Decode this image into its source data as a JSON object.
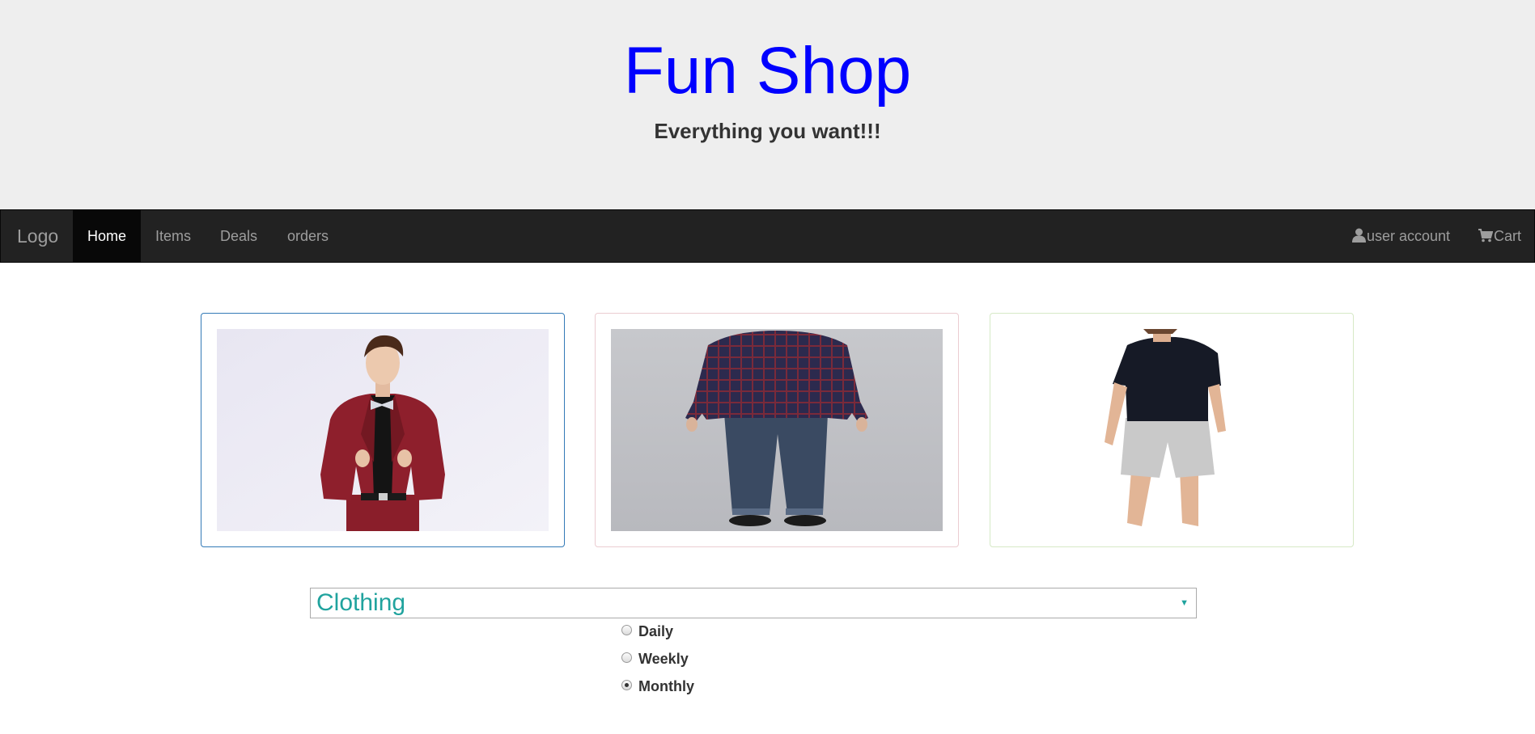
{
  "header": {
    "title": "Fun Shop",
    "tagline": "Everything you want!!!"
  },
  "navbar": {
    "brand": "Logo",
    "items": [
      {
        "label": "Home",
        "active": true
      },
      {
        "label": "Items",
        "active": false
      },
      {
        "label": "Deals",
        "active": false
      },
      {
        "label": "orders",
        "active": false
      }
    ],
    "right": [
      {
        "label": "user account",
        "icon": "user-icon"
      },
      {
        "label": "Cart",
        "icon": "cart-icon"
      }
    ]
  },
  "products": [
    {
      "image": "man in burgundy suit with bow tie",
      "border_color": "#337ab7"
    },
    {
      "image": "man in plaid shirt and jeans, back view",
      "border_color": "#ebccd1"
    },
    {
      "image": "man in black t-shirt and grey shorts",
      "border_color": "#d6e9c6"
    }
  ],
  "category_select": {
    "selected": "Clothing",
    "icon": "triangle-down-icon"
  },
  "period_options": [
    {
      "label": "Daily",
      "checked": false
    },
    {
      "label": "Weekly",
      "checked": false
    },
    {
      "label": "Monthly",
      "checked": true
    }
  ],
  "colors": {
    "title": "#0000ff",
    "navbar_bg": "#222222",
    "select_text": "#20a39e"
  }
}
